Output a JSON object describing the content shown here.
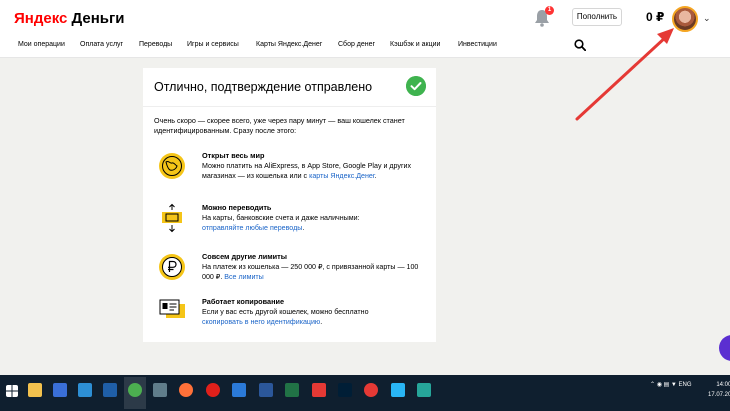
{
  "header": {
    "logo_brand": "Яндекс",
    "logo_product": "Деньги",
    "notification_count": "1",
    "topup_label": "Пополнить",
    "balance": "0 ₽"
  },
  "nav": {
    "items": [
      {
        "label": "Мои операции"
      },
      {
        "label": "Оплата услуг"
      },
      {
        "label": "Переводы"
      },
      {
        "label": "Игры и сервисы"
      },
      {
        "label": "Карты Яндекс.Денег"
      },
      {
        "label": "Сбор денег"
      },
      {
        "label": "Кэшбэк и акции"
      },
      {
        "label": "Инвестиции"
      }
    ]
  },
  "card": {
    "title": "Отлично, подтверждение отправлено",
    "intro": "Очень скоро — скорее всего, уже через пару минут — ваш кошелек станет идентифицированным. Сразу после этого:",
    "features": [
      {
        "title": "Открыт весь мир",
        "text": "Можно платить на AliExpress, в App Store, Google Play и других магазинах — из кошелька или с",
        "link": "карты Яндекс.Денег",
        "tail": "."
      },
      {
        "title": "Можно переводить",
        "text": "На карты, банковские счета и даже наличными:",
        "link": "отправляйте любые переводы",
        "tail": "."
      },
      {
        "title": "Совсем другие лимиты",
        "text": "На платеж из кошелька — 250 000 ₽, с привязанной карты — 100 000 ₽.",
        "link": "Все лимиты",
        "tail": ""
      },
      {
        "title": "Работает копирование",
        "text": "Если у вас есть другой кошелек, можно бесплатно",
        "link": "скопировать в него идентификацию",
        "tail": "."
      }
    ]
  },
  "taskbar": {
    "lang": "ENG",
    "time": "14:00",
    "date": "17.07.20"
  },
  "colors": {
    "brand_red": "#ff0000",
    "link_blue": "#1a64c8",
    "success_green": "#3fb34f",
    "icon_yellow": "#f5c518",
    "annotation_red": "#e53935"
  }
}
